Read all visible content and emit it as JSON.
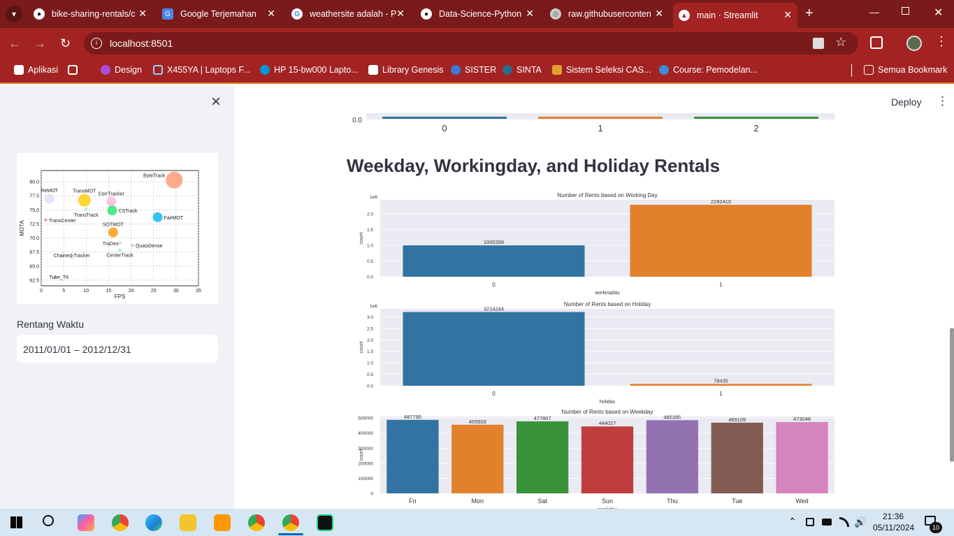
{
  "tabs": [
    {
      "title": "bike-sharing-rentals/c",
      "icon": "github-icon"
    },
    {
      "title": "Google Terjemahan",
      "icon": "google-translate-icon"
    },
    {
      "title": "weathersite adalah - P",
      "icon": "google-icon"
    },
    {
      "title": "Data-Science-Python",
      "icon": "github-icon"
    },
    {
      "title": "raw.githubuserconten",
      "icon": "globe-icon"
    },
    {
      "title": "main · Streamlit",
      "icon": "streamlit-icon"
    }
  ],
  "address": {
    "url": "localhost:8501"
  },
  "bookmarks": [
    {
      "label": "Aplikasi"
    },
    {
      "label": "Design"
    },
    {
      "label": "X455YA | Laptops F..."
    },
    {
      "label": "HP 15-bw000 Lapto..."
    },
    {
      "label": "Library Genesis"
    },
    {
      "label": "SISTER"
    },
    {
      "label": "SINTA"
    },
    {
      "label": "Sistem Seleksi CAS..."
    },
    {
      "label": "Course: Pemodelan..."
    },
    {
      "label": "Semua Bookmark"
    }
  ],
  "sidebar": {
    "close_symbol": "×",
    "date_label": "Rentang Waktu",
    "date_value": "2011/01/01 – 2012/12/31",
    "logo_chart": {
      "xlabel": "FPS",
      "ylabel": "MOTA",
      "xticks": [
        "0",
        "5",
        "10",
        "15",
        "20",
        "25",
        "30",
        "35"
      ],
      "yticks": [
        "62.5",
        "65.0",
        "67.5",
        "70.0",
        "72.5",
        "75.0",
        "77.5",
        "80.0"
      ],
      "points": [
        {
          "label": "ByteTrack",
          "x": 29.6,
          "y": 80.3,
          "color": "#fca98c"
        },
        {
          "label": "ReMOT",
          "x": 1.8,
          "y": 77.0,
          "color": "#e7e2fb"
        },
        {
          "label": "TransMOT",
          "x": 9.6,
          "y": 76.7,
          "color": "#ffd633"
        },
        {
          "label": "CorrTracker",
          "x": 15.6,
          "y": 76.5,
          "color": "#f9c7dc"
        },
        {
          "label": "CSTrack",
          "x": 15.8,
          "y": 74.9,
          "color": "#4ce88a"
        },
        {
          "label": "TransTrack",
          "x": 10.0,
          "y": 75.2,
          "color": "#b6f2e0"
        },
        {
          "label": "FairMOT",
          "x": 25.9,
          "y": 73.7,
          "color": "#33c2f2"
        },
        {
          "label": "TransCenter",
          "x": 1.0,
          "y": 73.2,
          "color": "#f2a3ce"
        },
        {
          "label": "SOTMOT",
          "x": 16.0,
          "y": 71.0,
          "color": "#ffab33"
        },
        {
          "label": "TraDes",
          "x": 17.5,
          "y": 69.1,
          "color": "#c6ecc6"
        },
        {
          "label": "QuasiDense",
          "x": 20.3,
          "y": 68.7,
          "color": "#d8d8d8"
        },
        {
          "label": "Chained-Tracker",
          "x": 6.8,
          "y": 66.6,
          "color": "#dddddd"
        },
        {
          "label": "CenterTrack",
          "x": 17.5,
          "y": 67.8,
          "color": "#b3eadf"
        },
        {
          "label": "Tube_TK",
          "x": 3.0,
          "y": 63.0,
          "color": "#dddddd"
        }
      ]
    }
  },
  "header": {
    "deploy_label": "Deploy",
    "menu_symbol": "⋮"
  },
  "prev_chart": {
    "ytick": "0.0",
    "xticks": [
      "0",
      "1",
      "2"
    ],
    "colors": [
      "#3274a1",
      "#e1812c",
      "#3a923a"
    ]
  },
  "section_title": "Weekday, Workingday, and Holiday Rentals",
  "colors": {
    "blue": "#3274a1",
    "orange": "#e1812c",
    "green": "#3a923a",
    "red": "#c03d3e",
    "purple": "#9372b2",
    "brown": "#845b53",
    "pink": "#d684bd",
    "facet": "#eaeaf2"
  },
  "chart_data": [
    {
      "type": "bar",
      "title": "Number of Rents based on Working Day",
      "xlabel": "workingday",
      "ylabel": "count",
      "scale_label": "1e6",
      "categories": [
        "0",
        "1"
      ],
      "values": [
        1000269,
        2292410
      ],
      "value_labels": [
        "1000269",
        "2292410"
      ],
      "yticks": [
        "0.0",
        "0.5",
        "1.0",
        "1.5",
        "2.0"
      ],
      "ylim": [
        0,
        2450000
      ],
      "colors": [
        "#3274a1",
        "#e1812c"
      ]
    },
    {
      "type": "bar",
      "title": "Number of Rents based on Holiday",
      "xlabel": "holiday",
      "ylabel": "count",
      "scale_label": "1e6",
      "categories": [
        "0",
        "1"
      ],
      "values": [
        3214244,
        78435
      ],
      "value_labels": [
        "3214244",
        "78435"
      ],
      "yticks": [
        "0.0",
        "0.5",
        "1.0",
        "1.5",
        "2.0",
        "2.5",
        "3.0"
      ],
      "ylim": [
        0,
        3350000
      ],
      "colors": [
        "#3274a1",
        "#e1812c"
      ]
    },
    {
      "type": "bar",
      "title": "Number of Rents based on Weekday",
      "xlabel": "weekday",
      "ylabel": "count",
      "scale_label": "",
      "categories": [
        "Fri",
        "Mon",
        "Sat",
        "Sun",
        "Thu",
        "Tue",
        "Wed"
      ],
      "values": [
        487790,
        455503,
        477807,
        444027,
        485395,
        469109,
        473048
      ],
      "value_labels": [
        "487790",
        "455503",
        "477807",
        "444027",
        "485395",
        "469109",
        "473048"
      ],
      "yticks": [
        "0",
        "100000",
        "200000",
        "300000",
        "400000",
        "500000"
      ],
      "ylim": [
        0,
        510000
      ],
      "colors": [
        "#3274a1",
        "#e1812c",
        "#3a923a",
        "#c03d3e",
        "#9372b2",
        "#845b53",
        "#d684bd"
      ]
    }
  ],
  "taskbar": {
    "time": "21:36",
    "date": "05/11/2024",
    "notif_count": "10"
  }
}
